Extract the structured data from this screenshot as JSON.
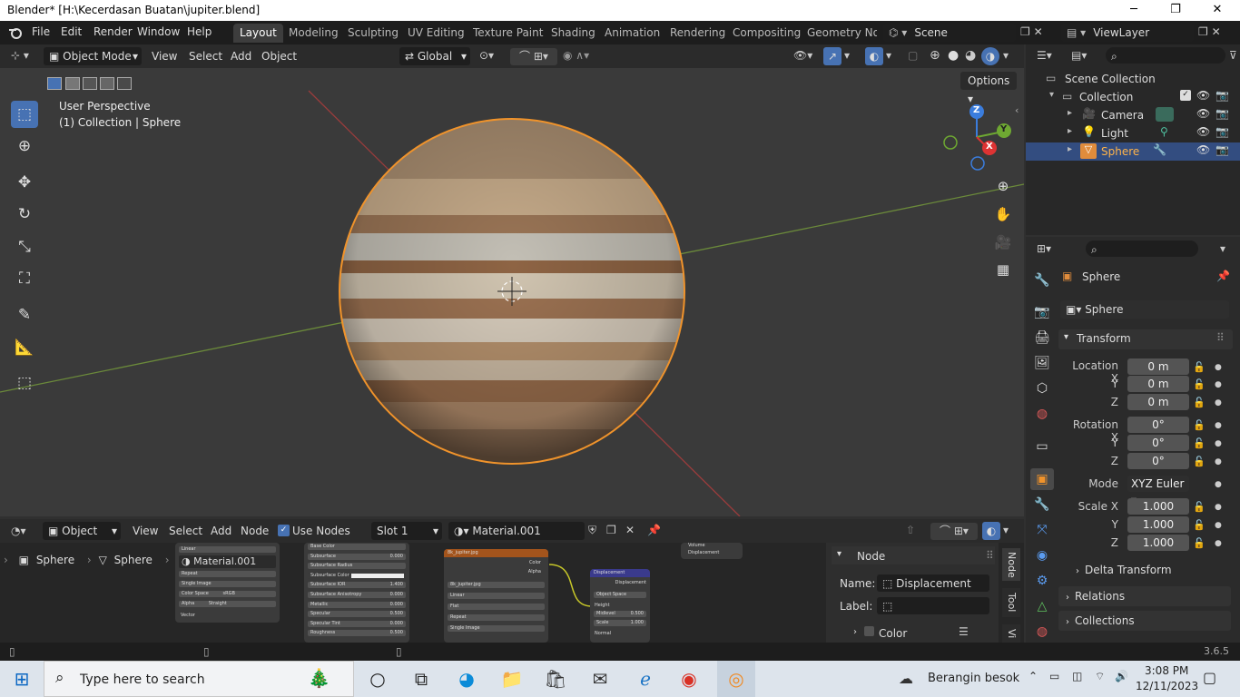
{
  "window": {
    "title": "Blender* [H:\\Kecerdasan Buatan\\jupiter.blend]",
    "minimize": "─",
    "restore": "❐",
    "close": "✕"
  },
  "menu": {
    "file": "File",
    "edit": "Edit",
    "render": "Render",
    "window": "Window",
    "help": "Help"
  },
  "workspaces": [
    "Layout",
    "Modeling",
    "Sculpting",
    "UV Editing",
    "Texture Paint",
    "Shading",
    "Animation",
    "Rendering",
    "Compositing",
    "Geometry Noc"
  ],
  "scene": {
    "name": "Scene",
    "view_layer": "ViewLayer"
  },
  "viewport_header": {
    "mode": "Object Mode",
    "view": "View",
    "select": "Select",
    "add": "Add",
    "object": "Object",
    "orientation": "Global",
    "options": "Options"
  },
  "viewport": {
    "perspective": "User Perspective",
    "collection_info": "(1) Collection | Sphere",
    "gizmo_x": "X",
    "gizmo_y": "Y",
    "gizmo_z": "Z"
  },
  "outliner": {
    "scene_collection": "Scene Collection",
    "collection": "Collection",
    "items": [
      "Camera",
      "Light",
      "Sphere"
    ]
  },
  "properties": {
    "object_name": "Sphere",
    "data_name": "Sphere",
    "transform_label": "Transform",
    "location_label": "Location X",
    "rotation_label": "Rotation X",
    "scale_label": "Scale X",
    "y_label": "Y",
    "z_label": "Z",
    "location": [
      "0 m",
      "0 m",
      "0 m"
    ],
    "rotation": [
      "0°",
      "0°",
      "0°"
    ],
    "mode_label": "Mode",
    "mode": "XYZ Euler",
    "scale": [
      "1.000",
      "1.000",
      "1.000"
    ],
    "delta_transform": "Delta Transform",
    "relations": "Relations",
    "collections": "Collections"
  },
  "node_editor": {
    "editor_type": "Object",
    "view": "View",
    "select": "Select",
    "add": "Add",
    "node": "Node",
    "use_nodes": "Use Nodes",
    "slot": "Slot 1",
    "material": "Material.001",
    "breadcrumb_object": "Sphere",
    "breadcrumb_data": "Sphere",
    "breadcrumb_material": "Material.001",
    "sidebar_node": "Node",
    "name_label": "Name:",
    "name_value": "Displacement",
    "label_label": "Label:",
    "color_label": "Color",
    "tab_node": "Node",
    "tab_tool": "Tool",
    "tab_view": "Vi",
    "image_node_title": "8k_jupiter.jpg",
    "image_node_file": "8k_jupiter.jpg",
    "displacement_title": "Displacement",
    "color_out": "Color",
    "alpha_out": "Alpha",
    "displacement_out": "Displacement",
    "object_space": "Object Space",
    "height": "Height",
    "midlevel_label": "Midlevel",
    "midlevel": "0.500",
    "scale_label": "Scale",
    "scale": "1.000",
    "normal": "Normal",
    "bsdf_rows": [
      "Base Color",
      "Subsurface",
      "Subsurface Radius",
      "Subsurface Color",
      "Subsurface IOR",
      "Subsurface Anisotropy",
      "Metallic",
      "Specular",
      "Specular Tint",
      "Roughness"
    ],
    "bsdf_vals": [
      "",
      "0.000",
      "",
      "",
      "1.400",
      "0.000",
      "0.000",
      "0.500",
      "0.000",
      "0.500"
    ],
    "left_node_rows": [
      "Linear",
      "Repeat",
      "Single Image",
      "Color Space",
      "Alpha"
    ],
    "left_node_vals": [
      "",
      "",
      "",
      "sRGB",
      "Straight"
    ],
    "left_node_vector": "Vector",
    "image_node_rows": [
      "Linear",
      "Flat",
      "Repeat",
      "Single Image"
    ],
    "volume_out": "Volume",
    "disp_node_out": "Displacement"
  },
  "statusbar": {
    "version": "3.6.5"
  },
  "taskbar": {
    "search_placeholder": "Type here to search",
    "weather": "Berangin besok",
    "time": "3:08 PM",
    "date": "12/11/2023"
  },
  "colors": {
    "accent": "#4772b3",
    "selection_orange": "#f0932b",
    "outliner_selected": "#334d80"
  }
}
